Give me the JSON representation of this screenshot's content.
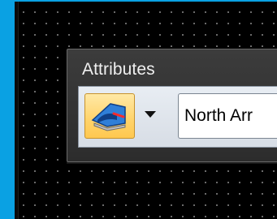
{
  "panel": {
    "title": "Attributes"
  },
  "toolbar": {
    "active_tool_icon": "level-display-icon",
    "dropdown_icon": "chevron-down-icon",
    "level_value": "North Arr"
  },
  "colors": {
    "desktop_background": "#0aa1e3",
    "canvas_background": "#000000",
    "grid_dot": "#7a7a7a",
    "tool_button_highlight": "#ffd36a"
  }
}
